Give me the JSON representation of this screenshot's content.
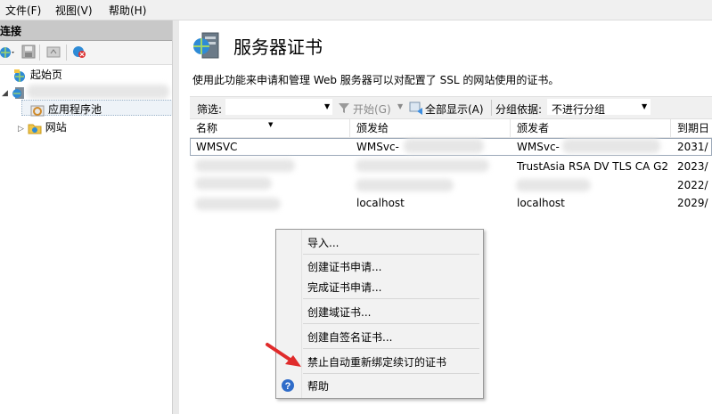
{
  "menubar": {
    "items": [
      "文件(F)",
      "视图(V)",
      "帮助(H)"
    ]
  },
  "connections": {
    "header": "连接",
    "tree": {
      "start_page": "起始页",
      "app_pools": "应用程序池",
      "sites": "网站"
    }
  },
  "main": {
    "title": "服务器证书",
    "description": "使用此功能来申请和管理 Web 服务器可以对配置了 SSL 的网站使用的证书。",
    "filter": {
      "label": "筛选:",
      "start_label": "开始(G)",
      "show_all_label": "全部显示(A)",
      "group_label": "分组依据:",
      "group_value": "不进行分组"
    },
    "columns": [
      "名称",
      "颁发给",
      "颁发者",
      "到期日"
    ],
    "rows": [
      {
        "name": "WMSVC",
        "issued_to": "WMSvc-",
        "issued_by": "WMSvc-",
        "expires": "2031/"
      },
      {
        "name": "",
        "issued_to": "",
        "issued_by": "TrustAsia RSA DV TLS CA G2",
        "expires": "2023/"
      },
      {
        "name": "",
        "issued_to": "",
        "issued_by": "",
        "expires": "2022/"
      },
      {
        "name": "",
        "issued_to": "localhost",
        "issued_by": "localhost",
        "expires": "2029/"
      }
    ]
  },
  "context_menu": {
    "items": [
      "导入...",
      "创建证书申请...",
      "完成证书申请...",
      "创建域证书...",
      "创建自签名证书...",
      "禁止自动重新绑定续订的证书",
      "帮助"
    ]
  },
  "colors": {
    "arrow": "#e02b2b",
    "selection_border": "#9ca9b9",
    "header_bg": "#c8c8c8"
  }
}
